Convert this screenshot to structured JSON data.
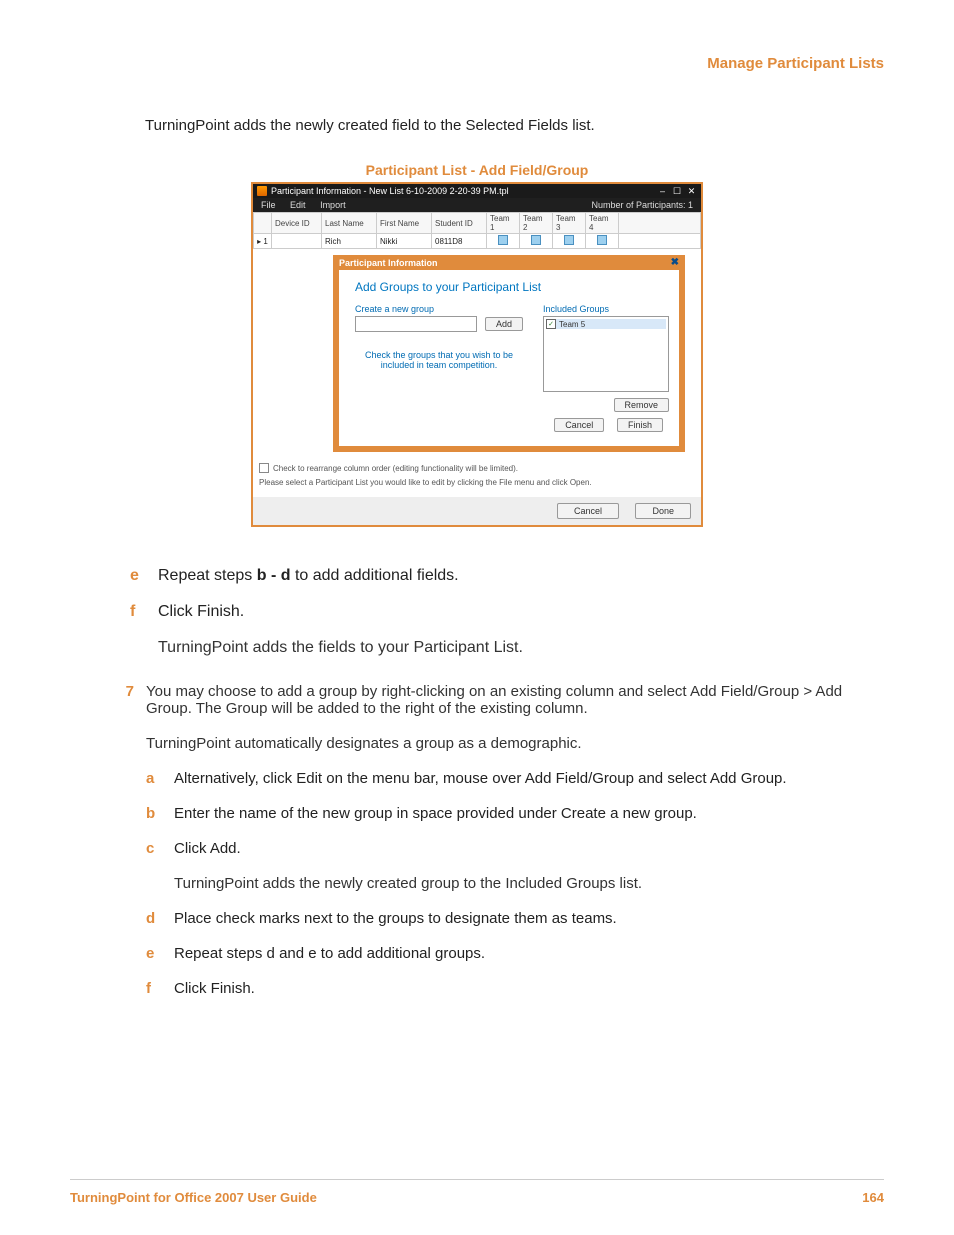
{
  "header": {
    "title": "Manage Participant Lists"
  },
  "intro_top": "TurningPoint adds the newly created field to the Selected Fields list.",
  "figure_caption": "Participant List - Add Field/Group",
  "screenshot": {
    "window_title": "Participant Information - New List 6-10-2009 2-20-39 PM.tpl",
    "menus": {
      "file": "File",
      "edit": "Edit",
      "import": "Import"
    },
    "participant_count_label": "Number of Participants: 1",
    "columns": {
      "rowhead": "",
      "device_id": "Device ID",
      "last_name": "Last Name",
      "first_name": "First Name",
      "student_id": "Student ID",
      "team1": "Team 1",
      "team2": "Team 2",
      "team3": "Team 3",
      "team4": "Team 4"
    },
    "row": {
      "rowhead": "1",
      "device_id": "",
      "last_name": "Rich",
      "first_name": "Nikki",
      "student_id": "0811D8"
    },
    "modal": {
      "title": "Participant Information",
      "heading": "Add Groups to your Participant List",
      "create_label": "Create a new group",
      "add_btn": "Add",
      "included_label": "Included Groups",
      "included_item": "Team 5",
      "hint": "Check the groups that you wish to\nbe included in team competition.",
      "remove_btn": "Remove",
      "cancel_btn": "Cancel",
      "finish_btn": "Finish"
    },
    "check_row": "Check to rearrange column order (editing functionality will be limited).",
    "status": "Please select a Participant List you would like to edit by clicking the File menu and click Open.",
    "footer": {
      "cancel": "Cancel",
      "done": "Done"
    },
    "title_controls": {
      "min": "–",
      "max": "☐",
      "close": "✕"
    }
  },
  "steps_upper": {
    "e": "Repeat steps b - d to add additional fields.",
    "e_bold": "b - d",
    "f": "Click Finish.",
    "f_after": "TurningPoint adds the fields to your Participant List."
  },
  "step7": {
    "num": "7",
    "line1": "You may choose to add a group by right-clicking on an existing column and select Add Field/Group > Add Group. The Group will be added to the right of the existing column.",
    "line2": "TurningPoint automatically designates a group as a demographic.",
    "a": "Alternatively, click Edit on the menu bar, mouse over Add Field/Group and select Add Group.",
    "b": "Enter the name of the new group in space provided under Create a new group.",
    "c": "Click Add.",
    "c_after": "TurningPoint adds the newly created group to the Included Groups list.",
    "d": "Place check marks next to the groups to designate them as teams.",
    "e": "Repeat steps d and e to add additional groups.",
    "f": "Click Finish."
  },
  "letters": {
    "a": "a",
    "b": "b",
    "c": "c",
    "d": "d",
    "e": "e",
    "f": "f"
  },
  "footer": {
    "left": "TurningPoint for Office 2007 User Guide",
    "right": "164"
  }
}
